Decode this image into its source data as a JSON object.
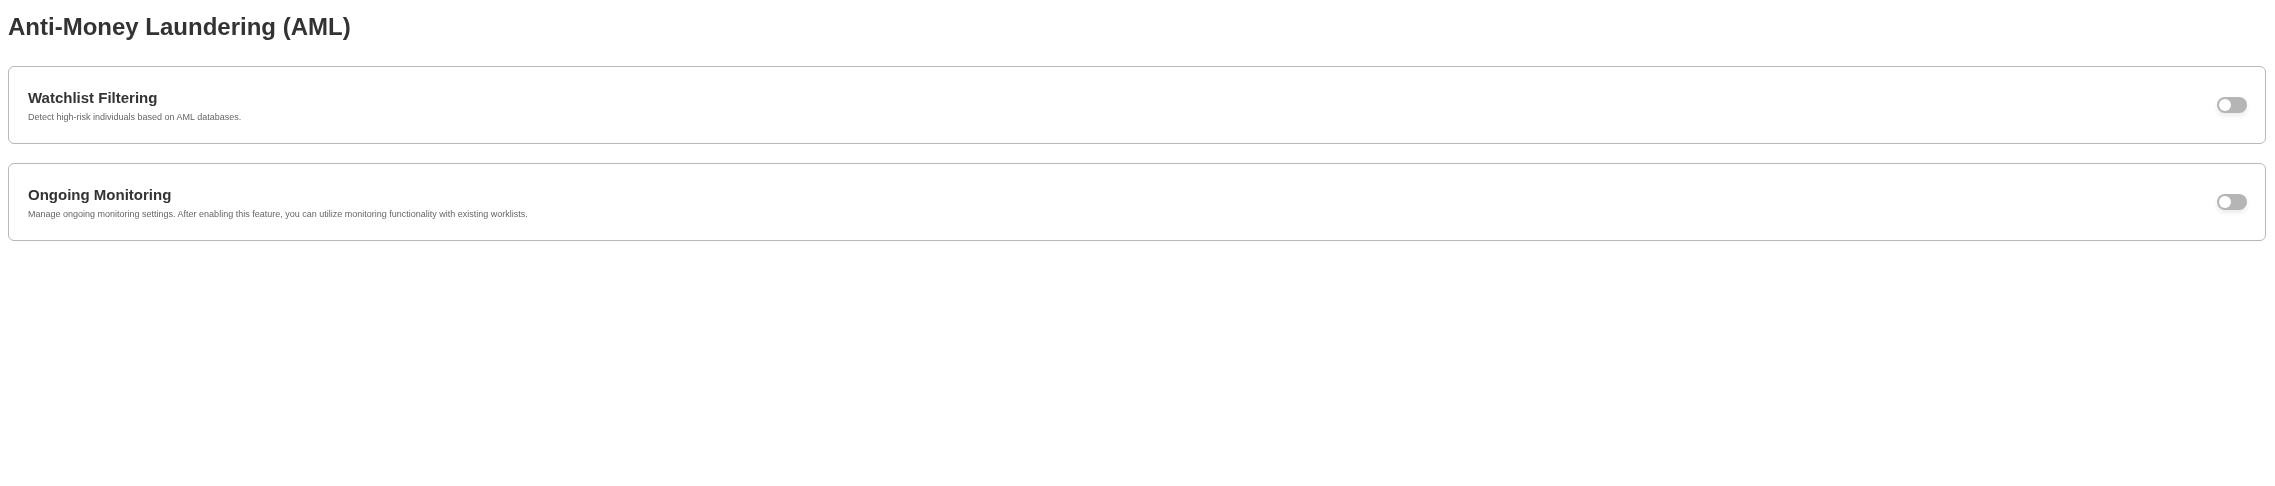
{
  "page": {
    "title": "Anti-Money Laundering (AML)"
  },
  "settings": [
    {
      "title": "Watchlist Filtering",
      "description": "Detect high-risk individuals based on AML databases.",
      "on": false
    },
    {
      "title": "Ongoing Monitoring",
      "description": "Manage ongoing monitoring settings. After enabling this feature, you can utilize monitoring functionality with existing worklists.",
      "on": false
    }
  ]
}
